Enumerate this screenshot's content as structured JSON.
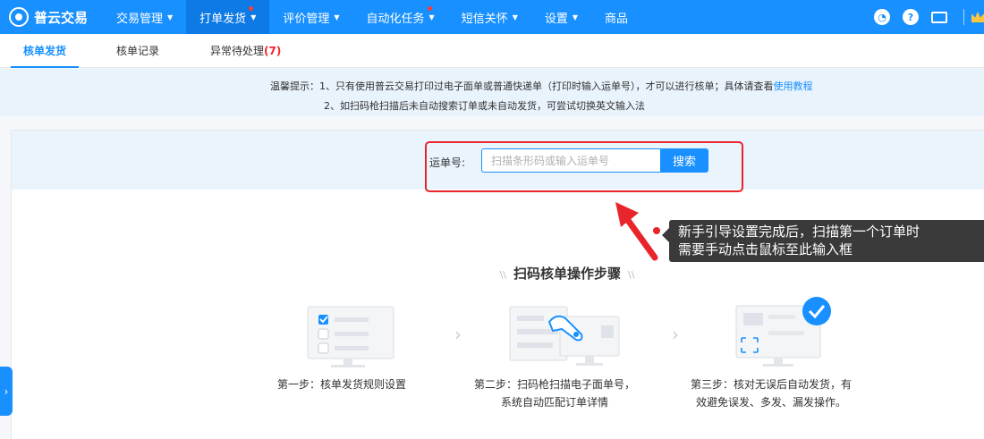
{
  "app": {
    "logo_text": "普云交易"
  },
  "nav": {
    "items": [
      {
        "label": "交易管理",
        "chevron": true,
        "dot": false,
        "active": false
      },
      {
        "label": "打单发货",
        "chevron": true,
        "dot": true,
        "active": true
      },
      {
        "label": "评价管理",
        "chevron": true,
        "dot": false,
        "active": false
      },
      {
        "label": "自动化任务",
        "chevron": true,
        "dot": true,
        "active": false
      },
      {
        "label": "短信关怀",
        "chevron": true,
        "dot": false,
        "active": false
      },
      {
        "label": "设置",
        "chevron": true,
        "dot": false,
        "active": false
      },
      {
        "label": "商品",
        "chevron": false,
        "dot": false,
        "active": false
      }
    ],
    "right_icons": [
      "notification-icon",
      "help-icon",
      "ticket-icon",
      "crown-icon"
    ],
    "help_glyph": "?"
  },
  "subtabs": {
    "check_ship": "核单发货",
    "check_record": "核单记录",
    "exception_prefix": "异常待处理",
    "exception_count": "(7)"
  },
  "tip": {
    "line1": "温馨提示：1、只有使用普云交易打印过电子面单或普通快递单（打印时输入运单号），才可以进行核单；具体请查看",
    "link": "使用教程",
    "line2": "2、如扫码枪扫描后未自动搜索订单或未自动发货，可尝试切换英文输入法"
  },
  "search": {
    "label": "运单号:",
    "placeholder": "扫描条形码或输入运单号",
    "value": "",
    "button": "搜索"
  },
  "guide": {
    "line1": "新手引导设置完成后，扫描第一个订单时",
    "line2": "需要手动点击鼠标至此输入框"
  },
  "steps": {
    "title": "扫码核单操作步骤",
    "title_deco": "\\\\",
    "items": [
      {
        "line1": "第一步：核单发货规则设置",
        "line2": ""
      },
      {
        "line1": "第二步：扫码枪扫描电子面单号，",
        "line2": "系统自动匹配订单详情"
      },
      {
        "line1": "第三步：核对无误后自动发货，有",
        "line2": "效避免误发、多发、漏发操作。"
      }
    ]
  },
  "colors": {
    "primary": "#1890ff",
    "highlight": "#e8252a",
    "tooltip_bg": "#3a3a3a"
  }
}
